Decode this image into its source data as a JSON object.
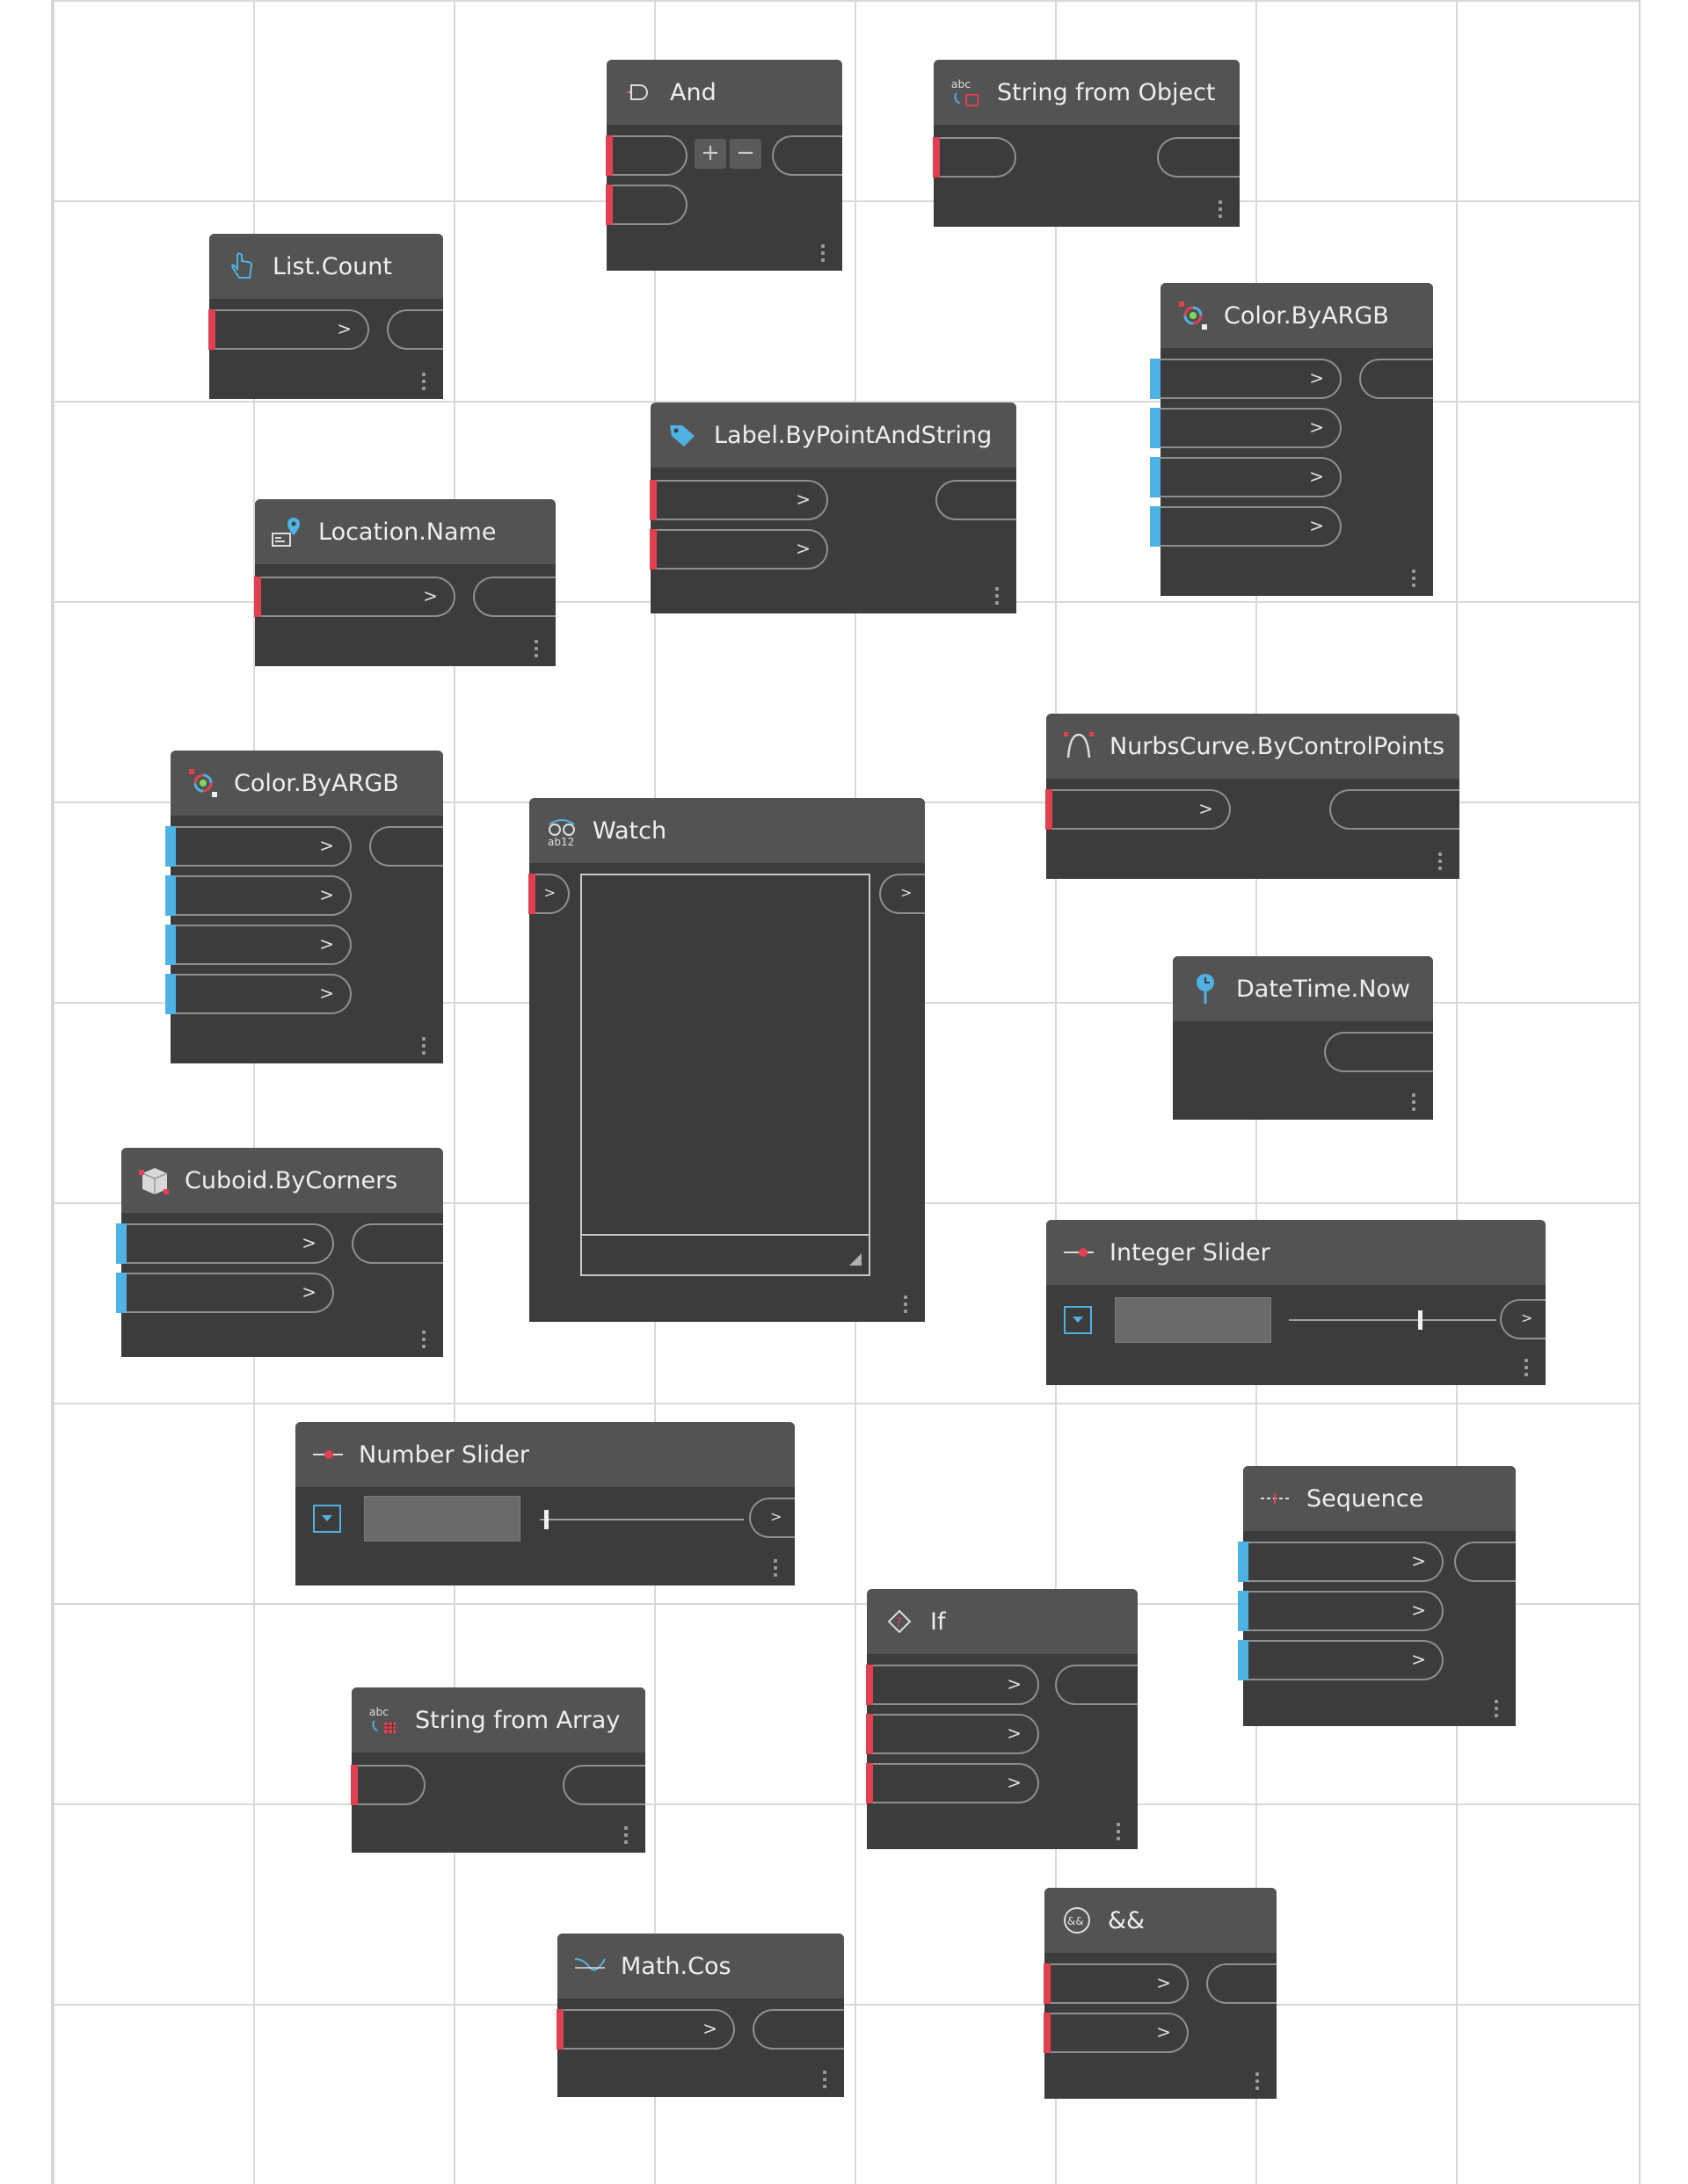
{
  "nodes": {
    "and": {
      "title": "And",
      "plus": "+",
      "minus": "−"
    },
    "string_from_object": {
      "title": "String from Object"
    },
    "list_count": {
      "title": "List.Count"
    },
    "color_byargb_1": {
      "title": "Color.ByARGB"
    },
    "label_bypointandstring": {
      "title": "Label.ByPointAndString"
    },
    "location_name": {
      "title": "Location.Name"
    },
    "color_byargb_2": {
      "title": "Color.ByARGB"
    },
    "watch": {
      "title": "Watch"
    },
    "nurbscurve": {
      "title": "NurbsCurve.ByControlPoints"
    },
    "datetime_now": {
      "title": "DateTime.Now"
    },
    "cuboid": {
      "title": "Cuboid.ByCorners"
    },
    "integer_slider": {
      "title": "Integer Slider",
      "thumb_fraction": 0.63
    },
    "number_slider": {
      "title": "Number Slider",
      "thumb_fraction": 0.03
    },
    "sequence": {
      "title": "Sequence"
    },
    "if": {
      "title": "If"
    },
    "string_from_array": {
      "title": "String from Array"
    },
    "math_cos": {
      "title": "Math.Cos"
    },
    "and_op": {
      "title": "&&"
    }
  },
  "glyphs": {
    "chevron": ">"
  },
  "colors": {
    "input_required": "#e04050",
    "input_optional": "#4fb2e4",
    "header": "#535353",
    "body": "#3c3c3c"
  }
}
